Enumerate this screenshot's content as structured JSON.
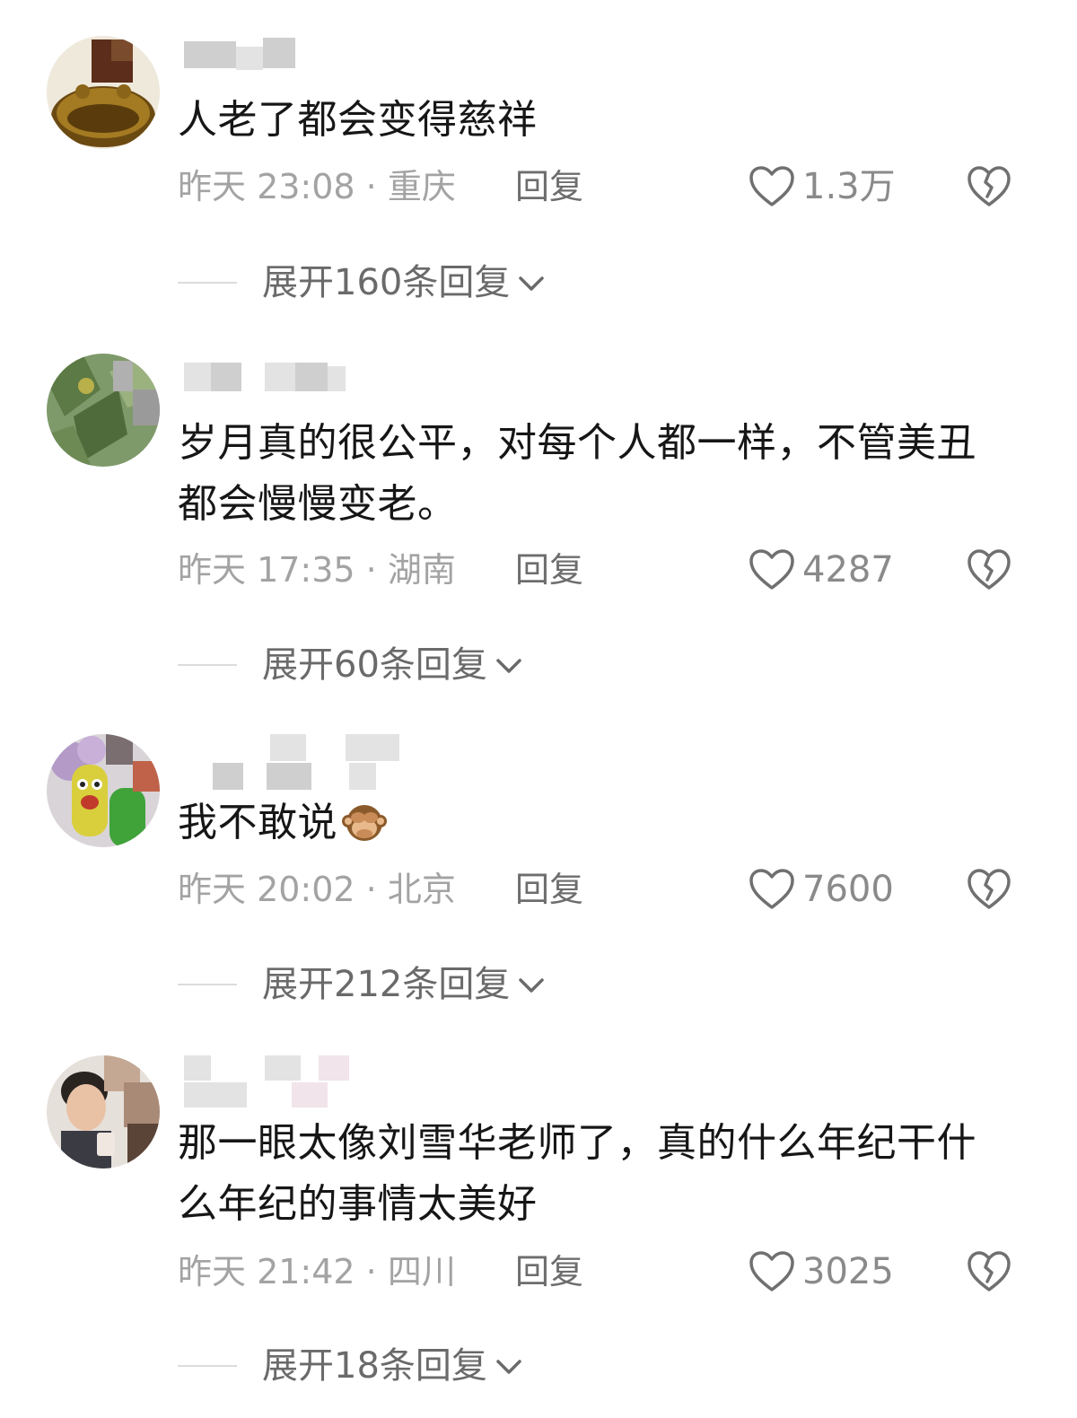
{
  "comments": [
    {
      "text": "人老了都会变得慈祥",
      "time": "昨天 23:08",
      "location": "重庆",
      "reply_label": "回复",
      "likes": "1.3万",
      "expand_label": "展开160条回复"
    },
    {
      "text": "岁月真的很公平，对每个人都一样，不管美丑都会慢慢变老。",
      "time": "昨天 17:35",
      "location": "湖南",
      "reply_label": "回复",
      "likes": "4287",
      "expand_label": "展开60条回复"
    },
    {
      "text": "我不敢说",
      "emoji": "see-no-evil-monkey",
      "time": "昨天 20:02",
      "location": "北京",
      "reply_label": "回复",
      "likes": "7600",
      "expand_label": "展开212条回复"
    },
    {
      "text": "那一眼太像刘雪华老师了，真的什么年纪干什么年纪的事情太美好",
      "time": "昨天 21:42",
      "location": "四川",
      "reply_label": "回复",
      "likes": "3025",
      "expand_label": "展开18条回复"
    }
  ],
  "separator": " · ",
  "icons": {
    "like": "heart-outline-icon",
    "dislike": "broken-heart-icon",
    "expand": "chevron-down-icon"
  },
  "colors": {
    "text": "#161616",
    "meta": "#a3a3a3",
    "reply": "#6d6d6d",
    "expand": "#6a6a6a"
  }
}
